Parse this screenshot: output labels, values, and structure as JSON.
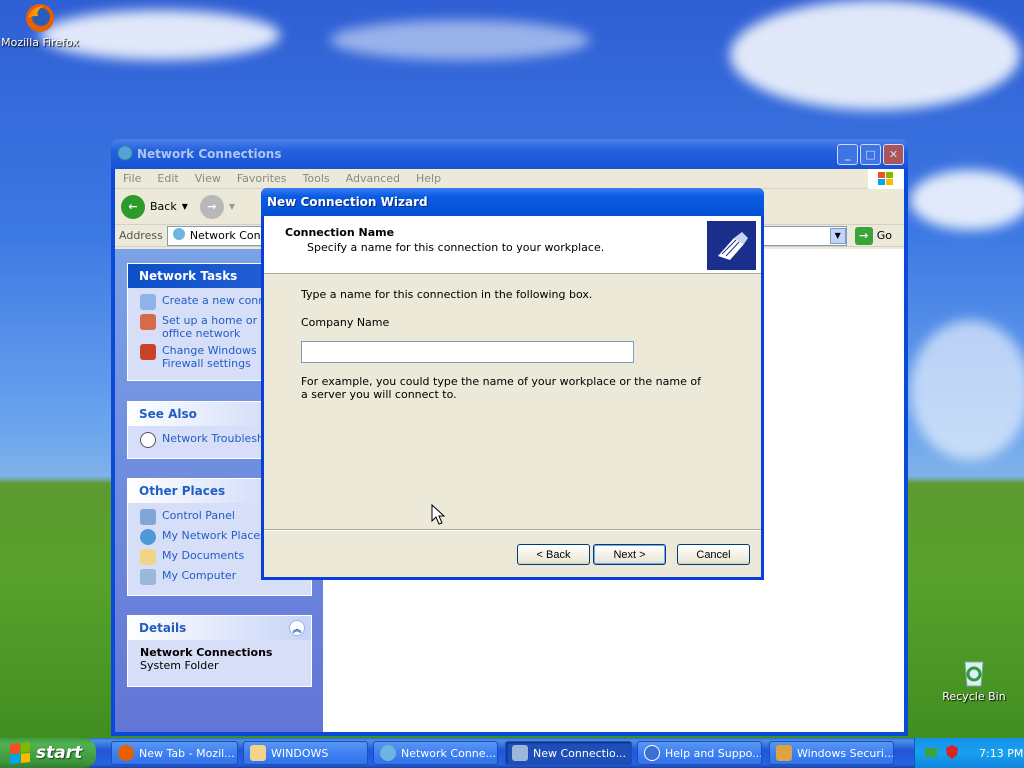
{
  "desktop": {
    "icons": [
      {
        "label": "Mozilla Firefox",
        "icon": "firefox-icon"
      },
      {
        "label": "Recycle Bin",
        "icon": "recycle-bin-icon"
      }
    ]
  },
  "explorer": {
    "title": "Network Connections",
    "menu": [
      "File",
      "Edit",
      "View",
      "Favorites",
      "Tools",
      "Advanced",
      "Help"
    ],
    "toolbar": {
      "back_label": "Back"
    },
    "address": {
      "label": "Address",
      "value": "Network Connections",
      "go_label": "Go"
    },
    "network_tasks": {
      "title": "Network Tasks",
      "items": [
        "Create a new connection",
        "Set up a home or small office network",
        "Change Windows Firewall settings"
      ]
    },
    "see_also": {
      "title": "See Also",
      "items": [
        "Network Troubleshooter"
      ]
    },
    "other_places": {
      "title": "Other Places",
      "items": [
        "Control Panel",
        "My Network Places",
        "My Documents",
        "My Computer"
      ]
    },
    "details": {
      "title": "Details",
      "name": "Network Connections",
      "type": "System Folder"
    }
  },
  "wizard": {
    "title": "New Connection Wizard",
    "header_title": "Connection Name",
    "header_subtitle": "Specify a name for this connection to your workplace.",
    "instruction": "Type a name for this connection in the following box.",
    "field_label": "Company Name",
    "field_value": "",
    "example": "For example, you could type the name of your workplace or the name of a server you will connect to.",
    "buttons": {
      "back": "< Back",
      "next": "Next >",
      "cancel": "Cancel"
    }
  },
  "taskbar": {
    "start_label": "start",
    "tasks": [
      {
        "label": "New Tab - Mozil...",
        "icon": "firefox-icon"
      },
      {
        "label": "WINDOWS",
        "icon": "folder-icon"
      },
      {
        "label": "Network Conne...",
        "icon": "network-connections-icon"
      },
      {
        "label": "New Connectio...",
        "icon": "new-connection-icon"
      },
      {
        "label": "Help and Suppo...",
        "icon": "help-icon"
      },
      {
        "label": "Windows Securi...",
        "icon": "security-shield-icon"
      }
    ],
    "clock": "7:13 PM"
  }
}
